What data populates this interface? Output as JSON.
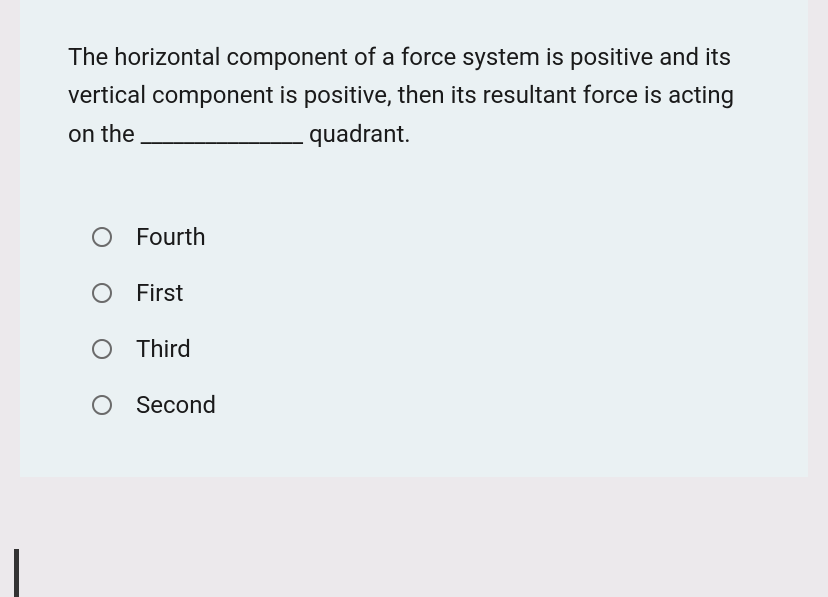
{
  "question": {
    "text": "The horizontal component of a force system is positive and its vertical component is positive, then its resultant force is acting on the _______________ quadrant."
  },
  "options": [
    {
      "label": "Fourth"
    },
    {
      "label": "First"
    },
    {
      "label": "Third"
    },
    {
      "label": "Second"
    }
  ]
}
